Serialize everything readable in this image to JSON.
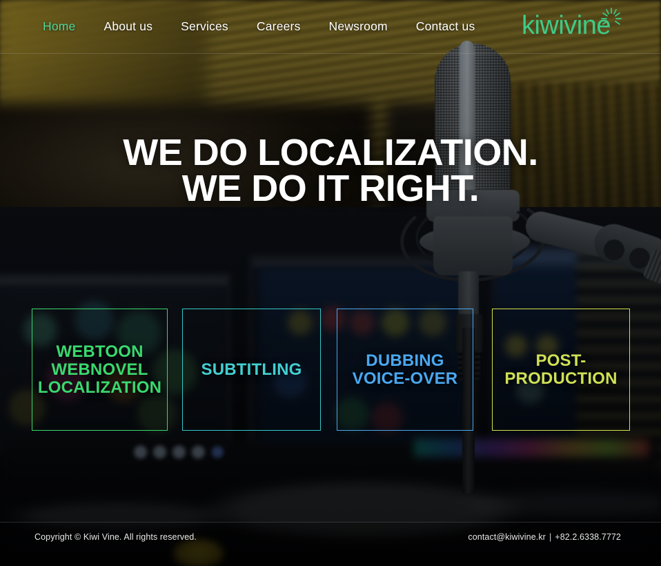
{
  "nav": {
    "items": [
      {
        "label": "Home",
        "active": true
      },
      {
        "label": "About us",
        "active": false
      },
      {
        "label": "Services",
        "active": false
      },
      {
        "label": "Careers",
        "active": false
      },
      {
        "label": "Newsroom",
        "active": false
      },
      {
        "label": "Contact us",
        "active": false
      }
    ],
    "active_color": "#4ed89a",
    "link_color": "#ffffff"
  },
  "logo": {
    "text": "kiwivine",
    "icon": "sun-burst-icon",
    "color": "#3ecb89"
  },
  "hero": {
    "line1": "WE DO LOCALIZATION.",
    "line2": "WE DO IT RIGHT.",
    "color": "#ffffff"
  },
  "cards": [
    {
      "label": "WEBTOON\nWEBNOVEL\nLOCALIZATION",
      "line1": "WEBTOON",
      "line2": "WEBNOVEL",
      "line3": "LOCALIZATION",
      "color": "#3ad86e"
    },
    {
      "label": "SUBTITLING",
      "line1": "SUBTITLING",
      "line2": "",
      "line3": "",
      "color": "#43cfd0"
    },
    {
      "label": "DUBBING\nVOICE-OVER",
      "line1": "DUBBING",
      "line2": "VOICE-OVER",
      "line3": "",
      "color": "#4aa8ef"
    },
    {
      "label": "POST-\nPRODUCTION",
      "line1": "POST-",
      "line2": "PRODUCTION",
      "line3": "",
      "color": "#cfe054"
    }
  ],
  "footer": {
    "copyright": "Copyright © Kiwi Vine. All rights reserved.",
    "email": "contact@kiwivine.kr",
    "separator": "|",
    "phone": "+82.2.6338.7772"
  },
  "background": {
    "scene": "recording-studio-microphone",
    "top_wall_color": "#7d6a1e",
    "lower_color": "#0b0f16"
  }
}
